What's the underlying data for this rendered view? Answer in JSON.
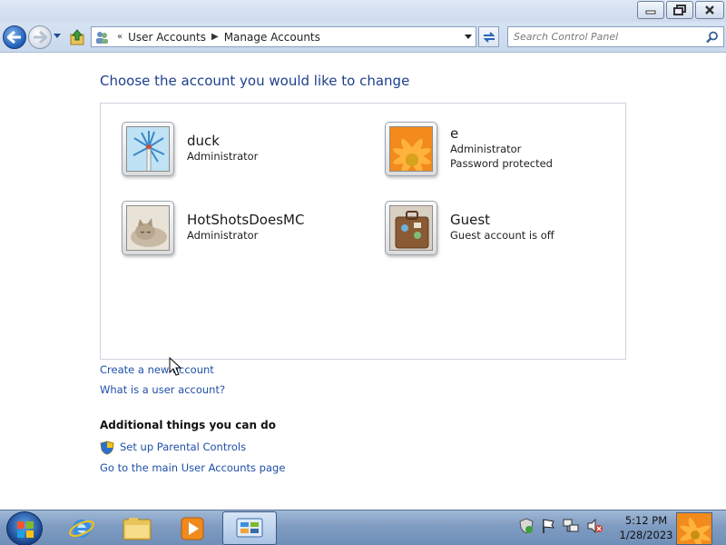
{
  "window": {
    "caption": {
      "minimize": "minimize-icon",
      "restore": "restore-icon",
      "close": "close-icon"
    }
  },
  "nav": {
    "back_icon": "back-arrow-icon",
    "forward_icon": "forward-arrow-icon",
    "breadcrumb": [
      "User Accounts",
      "Manage Accounts"
    ],
    "search_placeholder": "Search Control Panel"
  },
  "main": {
    "heading": "Choose the account you would like to change",
    "accounts": [
      {
        "name": "duck",
        "lines": [
          "Administrator"
        ],
        "picture": "windmill"
      },
      {
        "name": "e",
        "lines": [
          "Administrator",
          "Password protected"
        ],
        "picture": "orange-flower"
      },
      {
        "name": "HotShotsDoesMC",
        "lines": [
          "Administrator"
        ],
        "picture": "kitten"
      },
      {
        "name": "Guest",
        "lines": [
          "Guest account is off"
        ],
        "picture": "suitcase"
      }
    ],
    "links": {
      "create_account": "Create a new account",
      "what_is_account": "What is a user account?"
    },
    "additional": {
      "title": "Additional things you can do",
      "parental_controls": "Set up Parental Controls",
      "main_page": "Go to the main User Accounts page"
    }
  },
  "taskbar": {
    "apps": [
      "internet-explorer",
      "windows-explorer",
      "windows-media-player",
      "control-panel"
    ],
    "time": "5:12 PM",
    "date": "1/28/2023"
  },
  "colors": {
    "link": "#1f4fa8",
    "heading": "#1e3f8e",
    "taskbar": "#7f9cc2"
  }
}
